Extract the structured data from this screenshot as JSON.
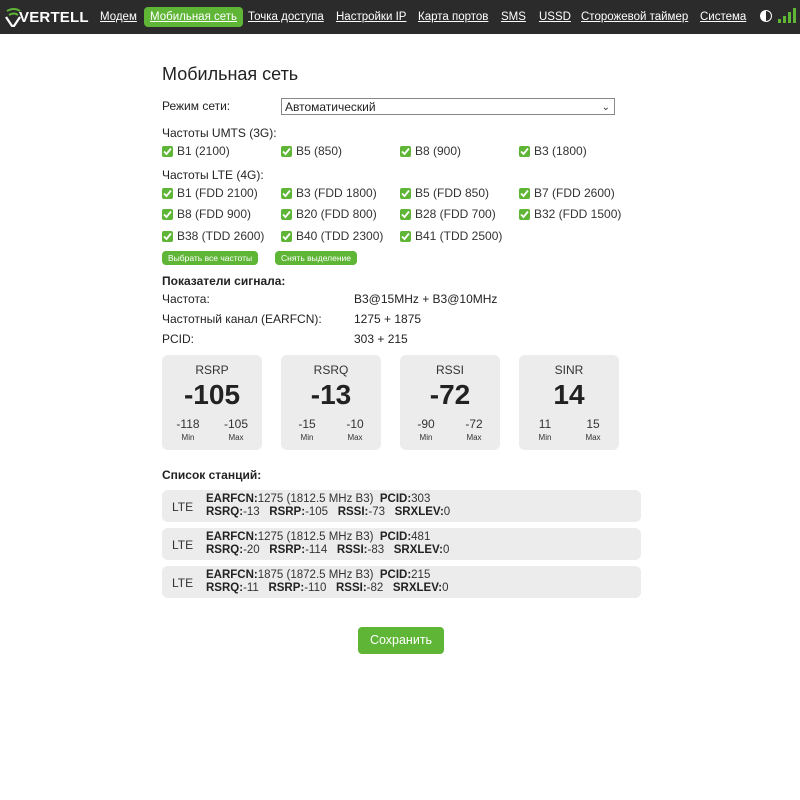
{
  "brand": {
    "logo_text": "VERTELL"
  },
  "nav": {
    "items": [
      {
        "label": "Модем"
      },
      {
        "label": "Мобильная сеть",
        "active": true
      },
      {
        "label": "Точка доступа"
      },
      {
        "label": "Настройки IP"
      },
      {
        "label": "Карта портов"
      },
      {
        "label": "SMS"
      },
      {
        "label": "USSD"
      },
      {
        "label": "Сторожевой таймер"
      },
      {
        "label": "Система"
      }
    ]
  },
  "page": {
    "title": "Мобильная сеть"
  },
  "network_mode": {
    "label": "Режим сети:",
    "value": "Автоматический"
  },
  "umts": {
    "label": "Частоты UMTS (3G):",
    "bands": [
      {
        "label": "B1 (2100)",
        "checked": true
      },
      {
        "label": "B5 (850)",
        "checked": true
      },
      {
        "label": "B8 (900)",
        "checked": true
      },
      {
        "label": "B3 (1800)",
        "checked": true
      }
    ]
  },
  "lte": {
    "label": "Частоты LTE (4G):",
    "bands": [
      {
        "label": "B1 (FDD 2100)",
        "checked": true
      },
      {
        "label": "B3 (FDD 1800)",
        "checked": true
      },
      {
        "label": "B5 (FDD 850)",
        "checked": true
      },
      {
        "label": "B7 (FDD 2600)",
        "checked": true
      },
      {
        "label": "B8 (FDD 900)",
        "checked": true
      },
      {
        "label": "B20 (FDD 800)",
        "checked": true
      },
      {
        "label": "B28 (FDD 700)",
        "checked": true
      },
      {
        "label": "B32 (FDD 1500)",
        "checked": true
      },
      {
        "label": "B38 (TDD 2600)",
        "checked": true
      },
      {
        "label": "B40 (TDD 2300)",
        "checked": true
      },
      {
        "label": "B41 (TDD 2500)",
        "checked": true
      }
    ]
  },
  "buttons": {
    "select_all": "Выбрать все частоты",
    "deselect": "Снять выделение",
    "save": "Сохранить"
  },
  "signal": {
    "label": "Показатели сигнала:",
    "rows": [
      {
        "name": "Частота:",
        "value": "B3@15MHz + B3@10MHz"
      },
      {
        "name": "Частотный канал (EARFCN):",
        "value": "1275 + 1875"
      },
      {
        "name": "PCID:",
        "value": "303 + 215"
      }
    ],
    "min_label": "Min",
    "max_label": "Max",
    "metrics": [
      {
        "name": "RSRP",
        "value": "-105",
        "min": "-118",
        "max": "-105"
      },
      {
        "name": "RSRQ",
        "value": "-13",
        "min": "-15",
        "max": "-10"
      },
      {
        "name": "RSSI",
        "value": "-72",
        "min": "-90",
        "max": "-72"
      },
      {
        "name": "SINR",
        "value": "14",
        "min": "11",
        "max": "15"
      }
    ]
  },
  "stations": {
    "label": "Список станций:",
    "keys": {
      "earfcn": "EARFCN:",
      "pcid": "PCID:",
      "rsrq": "RSRQ:",
      "rsrp": "RSRP:",
      "rssi": "RSSI:",
      "srxlev": "SRXLEV:"
    },
    "items": [
      {
        "type": "LTE",
        "earfcn": "1275 (1812.5 MHz B3)",
        "pcid": "303",
        "rsrq": "-13",
        "rsrp": "-105",
        "rssi": "-73",
        "srxlev": "0"
      },
      {
        "type": "LTE",
        "earfcn": "1275 (1812.5 MHz B3)",
        "pcid": "481",
        "rsrq": "-20",
        "rsrp": "-114",
        "rssi": "-83",
        "srxlev": "0"
      },
      {
        "type": "LTE",
        "earfcn": "1875 (1872.5 MHz B3)",
        "pcid": "215",
        "rsrq": "-11",
        "rsrp": "-110",
        "rssi": "-82",
        "srxlev": "0"
      }
    ]
  },
  "colors": {
    "accent": "#5fb536",
    "topbar": "#2b2b2b",
    "card": "#ececec"
  }
}
